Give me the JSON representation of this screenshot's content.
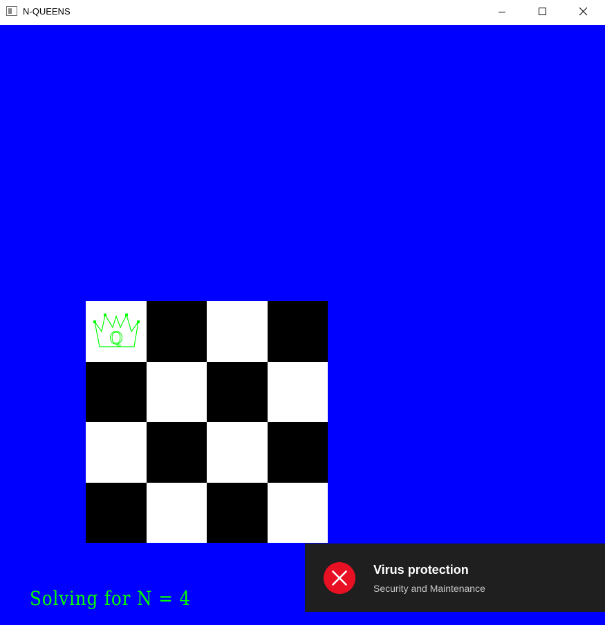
{
  "window": {
    "title": "N-QUEENS",
    "icons": {
      "app": "app-window-icon",
      "minimize": "minimize-icon",
      "maximize": "maximize-icon",
      "close": "close-icon"
    }
  },
  "colors": {
    "client_background": "#0000ff",
    "light_square": "#ffffff",
    "dark_square": "#000000",
    "queen": "#00ff00",
    "label": "#00ff00",
    "toast_background": "#1f1f1f",
    "toast_error": "#e81123"
  },
  "board": {
    "size": 4,
    "rows": [
      [
        "light",
        "dark",
        "light",
        "dark"
      ],
      [
        "dark",
        "light",
        "dark",
        "light"
      ],
      [
        "light",
        "dark",
        "light",
        "dark"
      ],
      [
        "dark",
        "light",
        "dark",
        "light"
      ]
    ],
    "queens": [
      {
        "row": 1,
        "col": 1,
        "letter": "Q"
      }
    ]
  },
  "status": {
    "label": "Solving for  N = 4"
  },
  "toast": {
    "icon": "error-circle-icon",
    "title": "Virus protection",
    "subtitle": "Security and Maintenance"
  }
}
